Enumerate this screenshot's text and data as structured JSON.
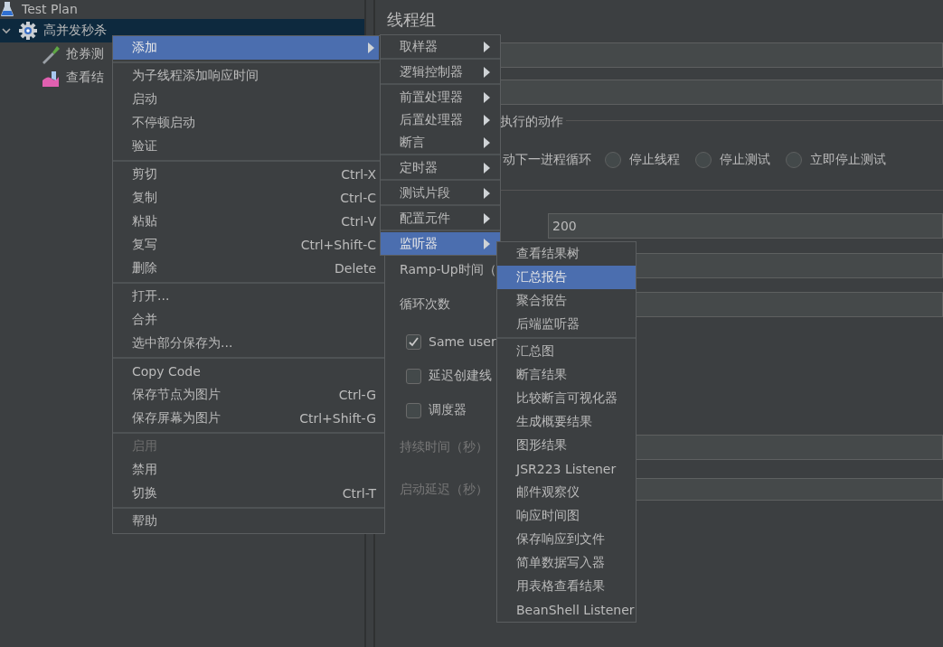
{
  "tree": [
    {
      "label": "Test Plan",
      "kind": "plan",
      "selected": false,
      "children": [
        {
          "label": "高并发秒杀",
          "kind": "thread_group",
          "selected": true,
          "expanded": true,
          "children": [
            {
              "label": "抢券测",
              "kind": "sampler",
              "selected": false
            },
            {
              "label": "查看结",
              "kind": "listener",
              "selected": false
            }
          ]
        }
      ]
    }
  ],
  "panel": {
    "title": "线程组",
    "error_action": {
      "legend": "执行的动作",
      "cut_label": "动下一进程循环",
      "options": [
        {
          "label": "停止线程",
          "selected": false
        },
        {
          "label": "停止测试",
          "selected": false
        },
        {
          "label": "立即停止测试",
          "selected": false
        }
      ]
    },
    "thread_count": {
      "value": "200"
    },
    "ramp_up": {
      "label": "Ramp-Up时间（"
    },
    "loop": {
      "label": "循环次数"
    },
    "checks": [
      {
        "label": "Same user",
        "checked": true
      },
      {
        "label": "延迟创建线",
        "checked": false
      },
      {
        "label": "调度器",
        "checked": false
      }
    ],
    "durations": [
      {
        "label": "持续时间（秒）",
        "disabled": true
      },
      {
        "label": "启动延迟（秒）",
        "disabled": true
      }
    ]
  },
  "context_menu": {
    "groups": [
      [
        {
          "label": "添加",
          "submenu": true,
          "selected": true,
          "disabled": false
        }
      ],
      [
        {
          "label": "为子线程添加响应时间",
          "selected": false,
          "disabled": false
        },
        {
          "label": "启动",
          "selected": false,
          "disabled": false
        },
        {
          "label": "不停顿启动",
          "selected": false,
          "disabled": false
        },
        {
          "label": "验证",
          "selected": false,
          "disabled": false
        }
      ],
      [
        {
          "label": "剪切",
          "shortcut": "Ctrl-X",
          "selected": false,
          "disabled": false
        },
        {
          "label": "复制",
          "shortcut": "Ctrl-C",
          "selected": false,
          "disabled": false
        },
        {
          "label": "粘贴",
          "shortcut": "Ctrl-V",
          "selected": false,
          "disabled": false
        },
        {
          "label": "复写",
          "shortcut": "Ctrl+Shift-C",
          "selected": false,
          "disabled": false
        },
        {
          "label": "删除",
          "shortcut": "Delete",
          "selected": false,
          "disabled": false
        }
      ],
      [
        {
          "label": "打开...",
          "selected": false,
          "disabled": false
        },
        {
          "label": "合并",
          "selected": false,
          "disabled": false
        },
        {
          "label": "选中部分保存为...",
          "selected": false,
          "disabled": false
        }
      ],
      [
        {
          "label": "Copy Code",
          "selected": false,
          "disabled": false
        },
        {
          "label": "保存节点为图片",
          "shortcut": "Ctrl-G",
          "selected": false,
          "disabled": false
        },
        {
          "label": "保存屏幕为图片",
          "shortcut": "Ctrl+Shift-G",
          "selected": false,
          "disabled": false
        }
      ],
      [
        {
          "label": "启用",
          "selected": false,
          "disabled": true
        },
        {
          "label": "禁用",
          "selected": false,
          "disabled": false
        },
        {
          "label": "切换",
          "shortcut": "Ctrl-T",
          "selected": false,
          "disabled": false
        }
      ],
      [
        {
          "label": "帮助",
          "selected": false,
          "disabled": false
        }
      ]
    ]
  },
  "add_menu": {
    "groups": [
      [
        {
          "label": "取样器",
          "selected": false
        }
      ],
      [
        {
          "label": "逻辑控制器",
          "selected": false
        }
      ],
      [
        {
          "label": "前置处理器",
          "selected": false
        },
        {
          "label": "后置处理器",
          "selected": false
        },
        {
          "label": "断言",
          "selected": false
        }
      ],
      [
        {
          "label": "定时器",
          "selected": false
        }
      ],
      [
        {
          "label": "测试片段",
          "selected": false
        }
      ],
      [
        {
          "label": "配置元件",
          "selected": false
        }
      ],
      [
        {
          "label": "监听器",
          "selected": true
        }
      ]
    ]
  },
  "listener_menu": {
    "groups": [
      [
        {
          "label": "查看结果树",
          "selected": false
        },
        {
          "label": "汇总报告",
          "selected": true
        },
        {
          "label": "聚合报告",
          "selected": false
        },
        {
          "label": "后端监听器",
          "selected": false
        }
      ],
      [
        {
          "label": "汇总图",
          "selected": false
        },
        {
          "label": "断言结果",
          "selected": false
        },
        {
          "label": "比较断言可视化器",
          "selected": false
        },
        {
          "label": "生成概要结果",
          "selected": false
        },
        {
          "label": "图形结果",
          "selected": false
        },
        {
          "label": "JSR223 Listener",
          "selected": false
        },
        {
          "label": "邮件观察仪",
          "selected": false
        },
        {
          "label": "响应时间图",
          "selected": false
        },
        {
          "label": "保存响应到文件",
          "selected": false
        },
        {
          "label": "简单数据写入器",
          "selected": false
        },
        {
          "label": "用表格查看结果",
          "selected": false
        },
        {
          "label": "BeanShell Listener",
          "selected": false
        }
      ]
    ]
  }
}
